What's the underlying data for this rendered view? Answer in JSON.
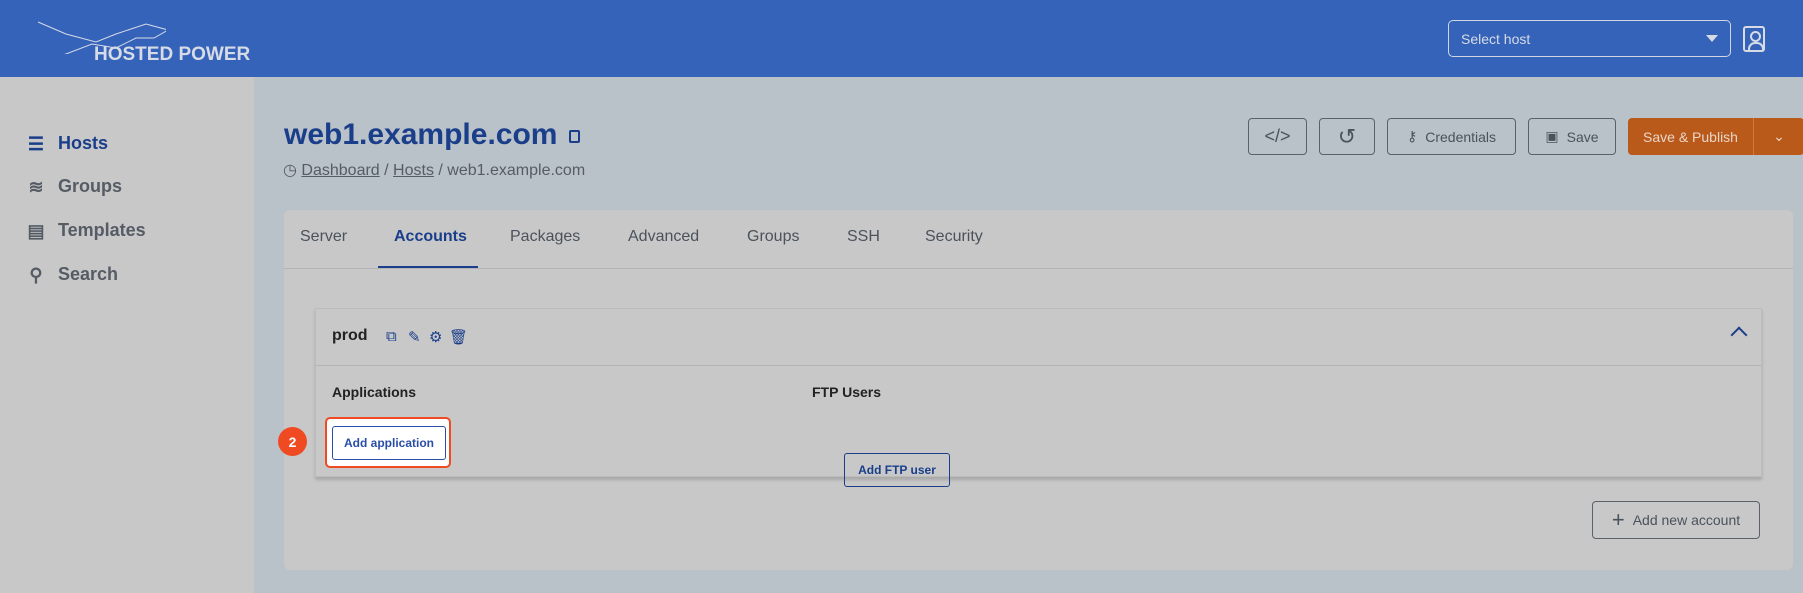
{
  "header": {
    "logo_text": "HOSTED POWER",
    "host_select_placeholder": "Select host"
  },
  "sidebar": {
    "items": [
      {
        "label": "Hosts",
        "icon": "server-icon",
        "active": true
      },
      {
        "label": "Groups",
        "icon": "layers-icon"
      },
      {
        "label": "Templates",
        "icon": "document-icon"
      },
      {
        "label": "Search",
        "icon": "search-icon"
      }
    ]
  },
  "page": {
    "title": "web1.example.com",
    "breadcrumb": [
      "Dashboard",
      "Hosts",
      "web1.example.com"
    ]
  },
  "toolbar": {
    "code_icon": "</>",
    "history_icon": "↺",
    "credentials": "Credentials",
    "save": "Save",
    "save_publish": "Save & Publish"
  },
  "tabs": [
    "Server",
    "Accounts",
    "Packages",
    "Advanced",
    "Groups",
    "SSH",
    "Security"
  ],
  "active_tab": "Accounts",
  "account": {
    "name": "prod",
    "applications_label": "Applications",
    "ftp_label": "FTP Users",
    "add_application": "Add application",
    "add_ftp": "Add FTP user"
  },
  "step_badge": "2",
  "add_account": "Add new account",
  "colors": {
    "header": "#3563b9",
    "accent": "#1a3e8a",
    "publish": "#b95a1b",
    "highlight": "#f04a23"
  }
}
